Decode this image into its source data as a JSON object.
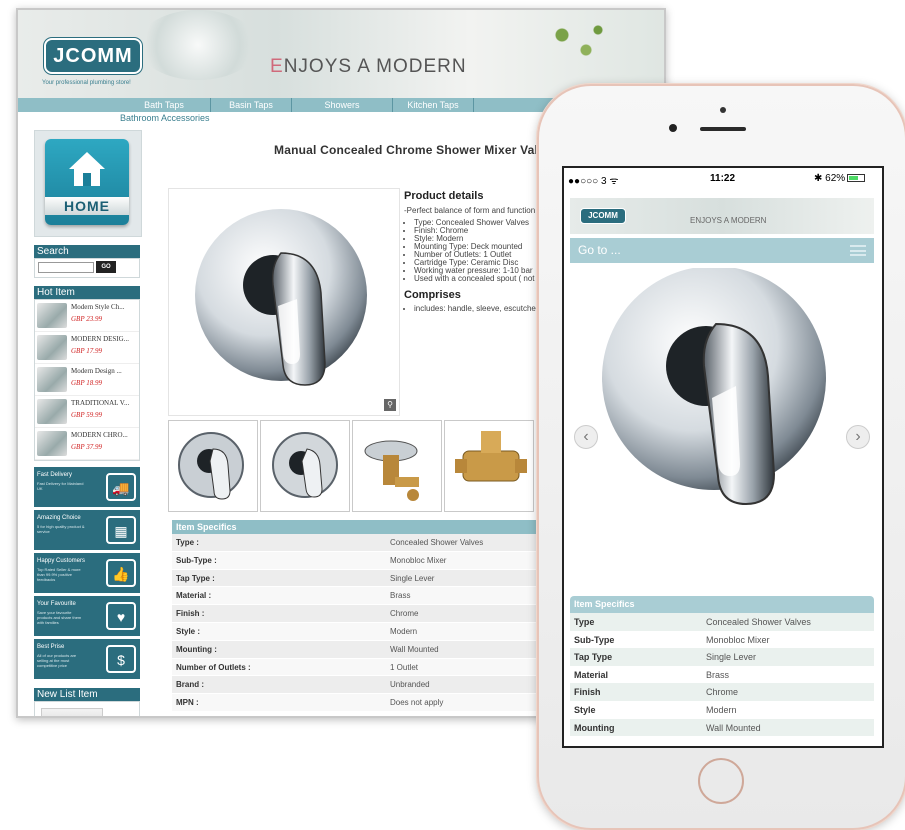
{
  "desktop": {
    "logo": "JCOMM",
    "tagline": "Your professional plumbing store!",
    "banner_text_accent": "E",
    "banner_text": "NJOYS A MODERN",
    "nav": [
      "Bath Taps",
      "Basin Taps",
      "Showers",
      "Kitchen Taps"
    ],
    "nav_row2": "Bathroom Accessories",
    "home_label": "HOME",
    "search_heading": "Search",
    "search_go": "GO",
    "hot_heading": "Hot Item",
    "hot_items": [
      {
        "name": "Modern Style Ch...",
        "price": "GBP 23.99"
      },
      {
        "name": "MODERN DESIG...",
        "price": "GBP 17.99"
      },
      {
        "name": "Modern Design ...",
        "price": "GBP 18.99"
      },
      {
        "name": "TRADITIONAL V...",
        "price": "GBP 59.99"
      },
      {
        "name": "MODERN CHRO...",
        "price": "GBP 37.99"
      }
    ],
    "promos": [
      {
        "title": "Fast Delivery",
        "sub": "Fast Delivery for Mainland UK",
        "icon": "truck-icon",
        "glyph": "🚚"
      },
      {
        "title": "Amazing Choice",
        "sub": "5 for high quality product & service",
        "icon": "store-icon",
        "glyph": "▦"
      },
      {
        "title": "Happy Customers",
        "sub": "Top Rated Seller & more than 99.9% positive feedbacks",
        "icon": "thumbs-up-icon",
        "glyph": "👍"
      },
      {
        "title": "Your Favourite",
        "sub": "Save your favourite products and share them with families",
        "icon": "heart-hand-icon",
        "glyph": "♥"
      },
      {
        "title": "Best Prise",
        "sub": "All of our products are selling at the most competitive price",
        "icon": "money-hand-icon",
        "glyph": "$"
      }
    ],
    "newlist_heading": "New List Item",
    "product_title": "Manual Concealed Chrome Shower Mixer Valve",
    "details_heading": "Product details",
    "details_intro": "-Perfect balance of form and function operate",
    "details_list": [
      "Type: Concealed Shower Valves",
      "Finish: Chrome",
      "Style: Modern",
      "Mounting Type: Deck mounted",
      "Number of Outlets: 1 Outlet",
      "Cartridge Type: Ceramic Disc",
      "Working water pressure: 1-10 bar",
      "Used with a concealed spout ( not"
    ],
    "comprises_heading": "Comprises",
    "comprises_list": [
      "includes: handle, sleeve, escutcheo"
    ],
    "specs_heading": "Item Specifics",
    "specs": [
      {
        "k": "Type :",
        "v": "Concealed Shower Valves"
      },
      {
        "k": "Sub-Type :",
        "v": "Monobloc Mixer"
      },
      {
        "k": "Tap Type :",
        "v": "Single Lever"
      },
      {
        "k": "Material :",
        "v": "Brass"
      },
      {
        "k": "Finish :",
        "v": "Chrome"
      },
      {
        "k": "Style :",
        "v": "Modern"
      },
      {
        "k": "Mounting :",
        "v": "Wall Mounted"
      },
      {
        "k": "Number of Outlets :",
        "v": "1 Outlet"
      },
      {
        "k": "Brand :",
        "v": "Unbranded"
      },
      {
        "k": "MPN :",
        "v": "Does not apply"
      }
    ]
  },
  "mobile": {
    "status_left": "●●○○○ 3 ᯤ",
    "status_time": "11:22",
    "status_right": "✱ 62%",
    "battery_level": 0.62,
    "logo": "JCOMM",
    "banner_text": "ENJOYS A MODERN",
    "goto": "Go to ...",
    "arrow_left": "‹",
    "arrow_right": "›",
    "specs_heading": "Item Specifics",
    "specs": [
      {
        "k": "Type",
        "v": "Concealed Shower Valves"
      },
      {
        "k": "Sub-Type",
        "v": "Monobloc Mixer"
      },
      {
        "k": "Tap Type",
        "v": "Single Lever"
      },
      {
        "k": "Material",
        "v": "Brass"
      },
      {
        "k": "Finish",
        "v": "Chrome"
      },
      {
        "k": "Style",
        "v": "Modern"
      },
      {
        "k": "Mounting",
        "v": "Wall Mounted"
      }
    ]
  }
}
